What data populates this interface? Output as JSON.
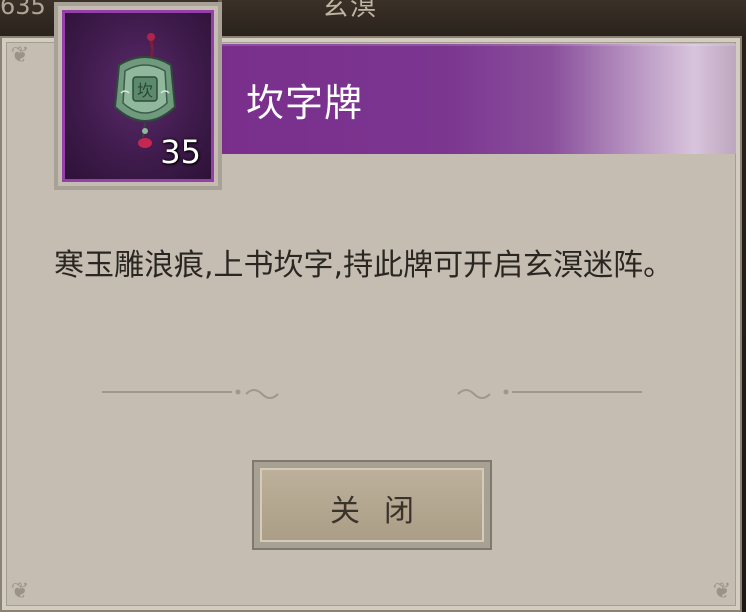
{
  "hud": {
    "number": "635",
    "title": "玄溟"
  },
  "item": {
    "name": "坎字牌",
    "count": "35",
    "icon": "jade-pendant-icon",
    "rarity_color": "#9440a8"
  },
  "description": "寒玉雕浪痕,上书坎字,持此牌可开启玄溟迷阵。",
  "buttons": {
    "close_label": "关闭"
  },
  "colors": {
    "banner_purple": "#7a2e8c",
    "panel_bg": "#c5bdb2",
    "button_bg": "#b5a891"
  }
}
